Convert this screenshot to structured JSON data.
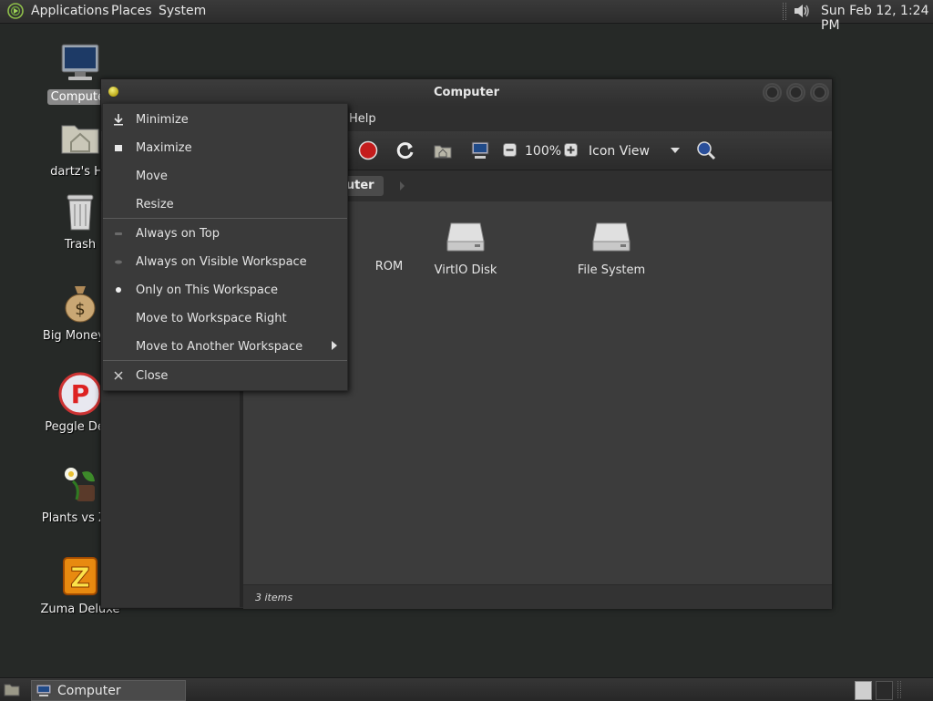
{
  "top_panel": {
    "menus": [
      "Applications",
      "Places",
      "System"
    ],
    "clock": "Sun Feb 12,  1:24 PM"
  },
  "desktop_icons": [
    {
      "label": "Computer",
      "icon": "computer-icon",
      "selected": true
    },
    {
      "label": "dartz's Ho",
      "icon": "home-folder-icon"
    },
    {
      "label": "Trash",
      "icon": "trash-icon"
    },
    {
      "label": "Big Money D",
      "icon": "money-bag-icon"
    },
    {
      "label": "Peggle Delu",
      "icon": "peggle-icon"
    },
    {
      "label": "Plants vs Zor",
      "icon": "plants-icon"
    },
    {
      "label": "Zuma Deluxe",
      "icon": "zuma-icon"
    }
  ],
  "window": {
    "title": "Computer",
    "menu_visible": "Help",
    "toolbar": {
      "zoom": "100%",
      "view_mode": "Icon View",
      "icons": [
        "stop-icon",
        "reload-icon",
        "home-icon",
        "computer-icon",
        "zoom-out-icon",
        "zoom-in-icon",
        "search-icon"
      ]
    },
    "location": "Computer",
    "location_visible": "mputer",
    "items": [
      {
        "label": "ROM",
        "full_label": "CD-ROM",
        "icon": "drive-icon"
      },
      {
        "label": "VirtIO Disk",
        "icon": "drive-icon"
      },
      {
        "label": "File System",
        "icon": "drive-icon"
      }
    ],
    "status": "3 items"
  },
  "context_menu": {
    "items": [
      {
        "label": "Minimize",
        "icon": "minimize-icon"
      },
      {
        "label": "Maximize",
        "icon": "maximize-icon"
      },
      {
        "label": "Move"
      },
      {
        "label": "Resize"
      },
      {
        "label": "Always on Top",
        "icon": "radio-off-icon"
      },
      {
        "label": "Always on Visible Workspace",
        "icon": "radio-off-icon"
      },
      {
        "label": "Only on This Workspace",
        "icon": "radio-on-icon",
        "checked": true
      },
      {
        "label": "Move to Workspace Right"
      },
      {
        "label": "Move to Another Workspace",
        "submenu": true
      },
      {
        "label": "Close",
        "icon": "close-icon"
      }
    ]
  },
  "taskbar": {
    "tasks": [
      {
        "label": "Computer",
        "icon": "computer-icon"
      }
    ]
  }
}
